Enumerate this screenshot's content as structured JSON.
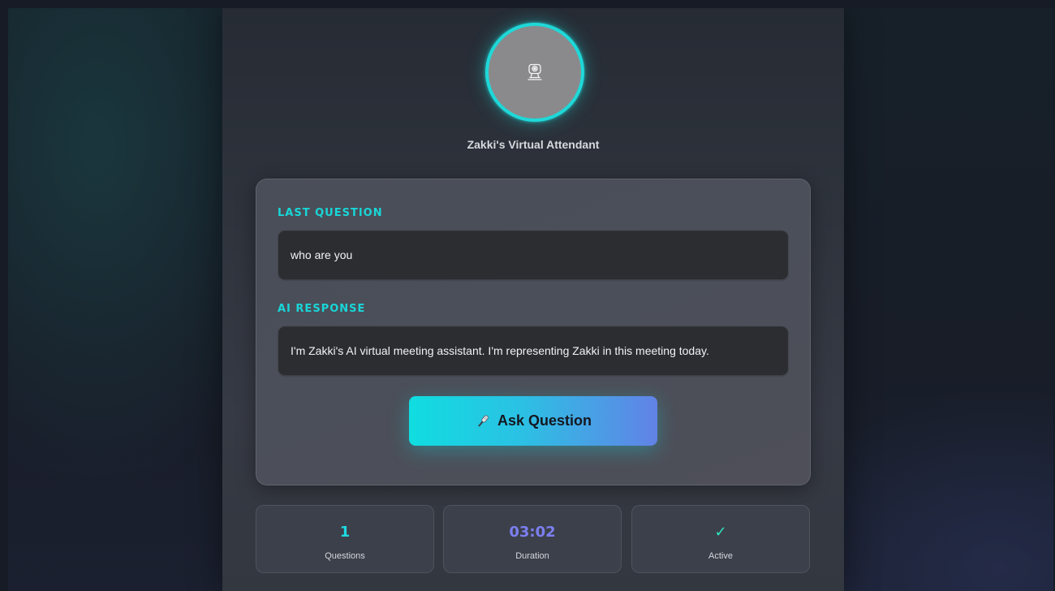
{
  "attendant": {
    "name": "Zakki's Virtual Attendant",
    "avatar_icon": "webcam-icon"
  },
  "qa": {
    "last_question_label": "LAST QUESTION",
    "last_question": "who are you",
    "ai_response_label": "AI RESPONSE",
    "ai_response": "I'm Zakki's AI virtual meeting assistant. I'm representing Zakki in this meeting today.",
    "ask_button_label": "Ask Question",
    "ask_button_icon": "microphone-icon"
  },
  "stats": [
    {
      "value": "1",
      "label": "Questions",
      "color": "#1fd8e0"
    },
    {
      "value": "03:02",
      "label": "Duration",
      "color": "#7b7ff0"
    },
    {
      "value": "✓",
      "label": "Active",
      "color": "#2ee6c0"
    }
  ],
  "colors": {
    "accent": "#18d6d8",
    "avatar_ring": "#1fd8d8",
    "button_gradient_start": "#10dde0",
    "button_gradient_end": "#6282e6"
  }
}
